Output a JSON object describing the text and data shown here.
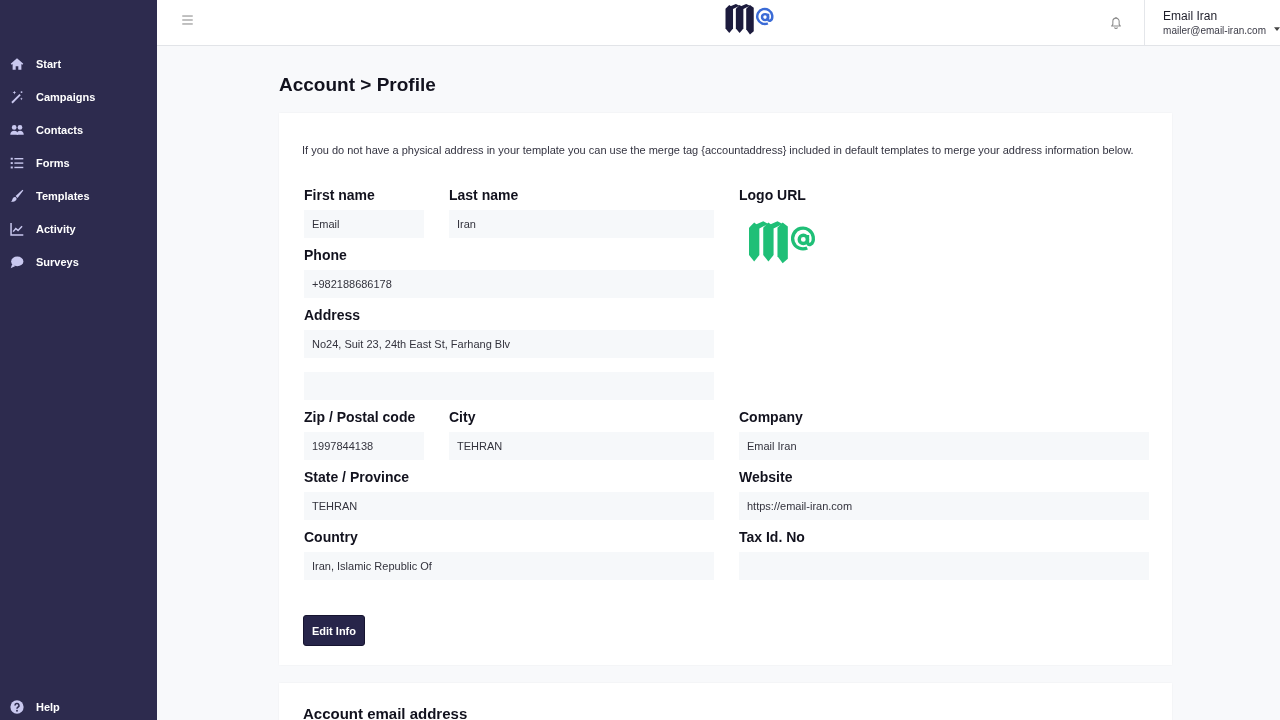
{
  "sidebar": {
    "items": [
      {
        "label": "Start",
        "selected": false
      },
      {
        "label": "Campaigns",
        "selected": false
      },
      {
        "label": "Contacts",
        "selected": false
      },
      {
        "label": "Forms",
        "selected": false
      },
      {
        "label": "Templates",
        "selected": false
      },
      {
        "label": "Activity",
        "selected": false
      },
      {
        "label": "Surveys",
        "selected": false
      }
    ],
    "footer_item": {
      "label": "Help"
    }
  },
  "topbar": {
    "user_name": "Email Iran",
    "user_email": "mailer@email-iran.com"
  },
  "page_title": "Account > Profile",
  "profile_card": {
    "note": "If you do not have a physical address in your template you can use the merge tag {accountaddress} included in default templates to merge your address information below.",
    "fields": [
      {
        "kind": "input",
        "label": "First name",
        "value": "Email"
      },
      {
        "kind": "input",
        "label": "Last name",
        "value": "Iran"
      },
      {
        "kind": "logo",
        "label": "Logo URL"
      },
      {
        "kind": "input",
        "label": "Phone",
        "value": "+982188686178"
      },
      {
        "kind": "input",
        "label": "Address",
        "value": "No24, Suit 23, 24th East St, Farhang Blv"
      },
      {
        "kind": "input"
      },
      {
        "kind": "input",
        "label": "Zip / Postal code",
        "value": "1997844138"
      },
      {
        "kind": "input",
        "label": "City",
        "value": "TEHRAN"
      },
      {
        "kind": "input",
        "label": "Company",
        "value": "Email Iran"
      },
      {
        "kind": "input",
        "label": "State / Province",
        "value": "TEHRAN"
      },
      {
        "kind": "input",
        "label": "Website",
        "value": "https://email-iran.com"
      },
      {
        "kind": "input",
        "label": "Country",
        "value": "Iran, Islamic Republic Of"
      },
      {
        "kind": "input",
        "label": "Tax Id. No"
      }
    ],
    "button": "Edit Info"
  },
  "email_card": {
    "title": "Account email address"
  }
}
